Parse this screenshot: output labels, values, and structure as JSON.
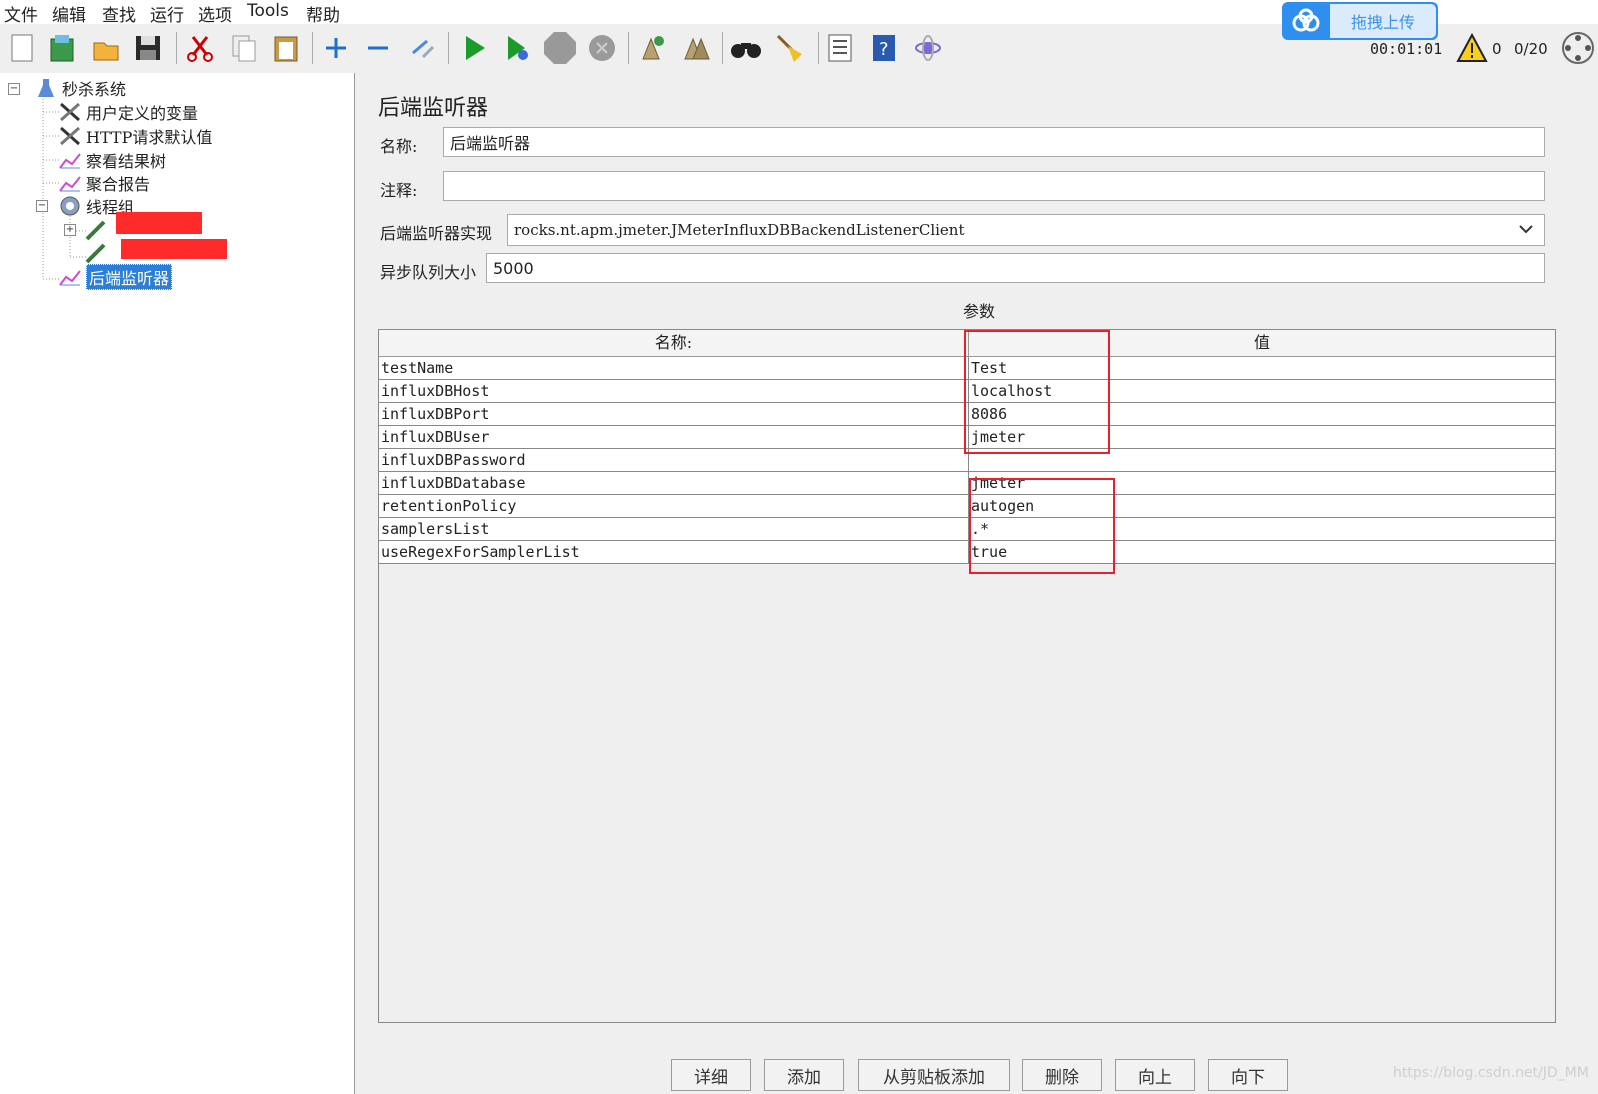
{
  "menu": [
    "文件",
    "编辑",
    "查找",
    "运行",
    "选项",
    "Tools",
    "帮助"
  ],
  "upload": {
    "label": "拖拽上传",
    "color": "#2e8ff0"
  },
  "toolbar": {
    "icons": [
      "new-icon",
      "templates-icon",
      "open-icon",
      "save-icon",
      "cut-icon",
      "copy-icon",
      "paste-icon",
      "expand-icon",
      "collapse-icon",
      "toggle-icon",
      "start-icon",
      "start-no-pauses-icon",
      "stop-icon",
      "shutdown-icon",
      "clear-icon",
      "clear-all-icon",
      "search-icon",
      "reset-search-icon",
      "function-helper-icon",
      "help-icon",
      "remote-icon"
    ],
    "timer": "00:01:01",
    "warnings": "0",
    "threads": "0/20"
  },
  "tree": {
    "root": "秒杀系统",
    "items": [
      {
        "label": "用户定义的变量",
        "icon": "tools-icon"
      },
      {
        "label": "HTTP请求默认值",
        "icon": "tools-icon"
      },
      {
        "label": "察看结果树",
        "icon": "graph-icon"
      },
      {
        "label": "聚合报告",
        "icon": "graph-icon"
      },
      {
        "label": "线程组",
        "icon": "gear-icon"
      },
      {
        "label": "后端监听器",
        "icon": "graph-icon",
        "selected": true
      }
    ]
  },
  "panel": {
    "title": "后端监听器",
    "name_label": "名称:",
    "name_value": "后端监听器",
    "comment_label": "注释:",
    "comment_value": "",
    "impl_label": "后端监听器实现",
    "impl_value": "rocks.nt.apm.jmeter.JMeterInfluxDBBackendListenerClient",
    "queue_label": "异步队列大小",
    "queue_value": "5000",
    "params_label": "参数"
  },
  "table": {
    "headers": [
      "名称:",
      "值"
    ],
    "rows": [
      {
        "name": "testName",
        "value": "Test"
      },
      {
        "name": "influxDBHost",
        "value": "localhost"
      },
      {
        "name": "influxDBPort",
        "value": "8086"
      },
      {
        "name": "influxDBUser",
        "value": "jmeter"
      },
      {
        "name": "influxDBPassword",
        "value": ""
      },
      {
        "name": "influxDBDatabase",
        "value": "jmeter"
      },
      {
        "name": "retentionPolicy",
        "value": "autogen"
      },
      {
        "name": "samplersList",
        "value": ".*"
      },
      {
        "name": "useRegexForSamplerList",
        "value": "true"
      }
    ]
  },
  "buttons": [
    "详细",
    "添加",
    "从剪贴板添加",
    "删除",
    "向上",
    "向下"
  ],
  "watermark": "https://blog.csdn.net/JD_MM",
  "colors": {
    "highlight": "#e5212b",
    "selection": "#2c7fd4",
    "redaction": "#ff2a2a"
  }
}
